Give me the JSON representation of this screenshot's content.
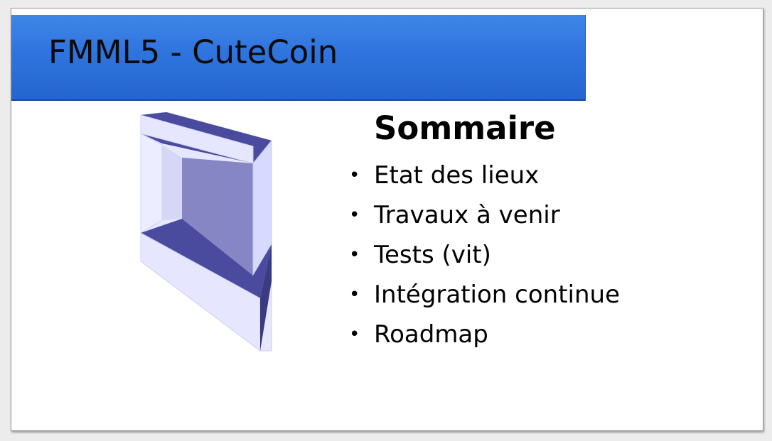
{
  "slide": {
    "title": "FMML5 - CuteCoin",
    "heading": "Sommaire",
    "bullet_char": "•",
    "items": [
      "Etat des lieux",
      "Travaux à venir",
      "Tests (vit)",
      "Intégration continue",
      "Roadmap"
    ]
  },
  "colors": {
    "title_bar": "#2f74de",
    "logo_dark": "#4a4b9e",
    "logo_light": "#e6e7ff",
    "logo_mid": "#8686c4"
  },
  "icons": {
    "logo": "cutecoin-logo-icon"
  }
}
